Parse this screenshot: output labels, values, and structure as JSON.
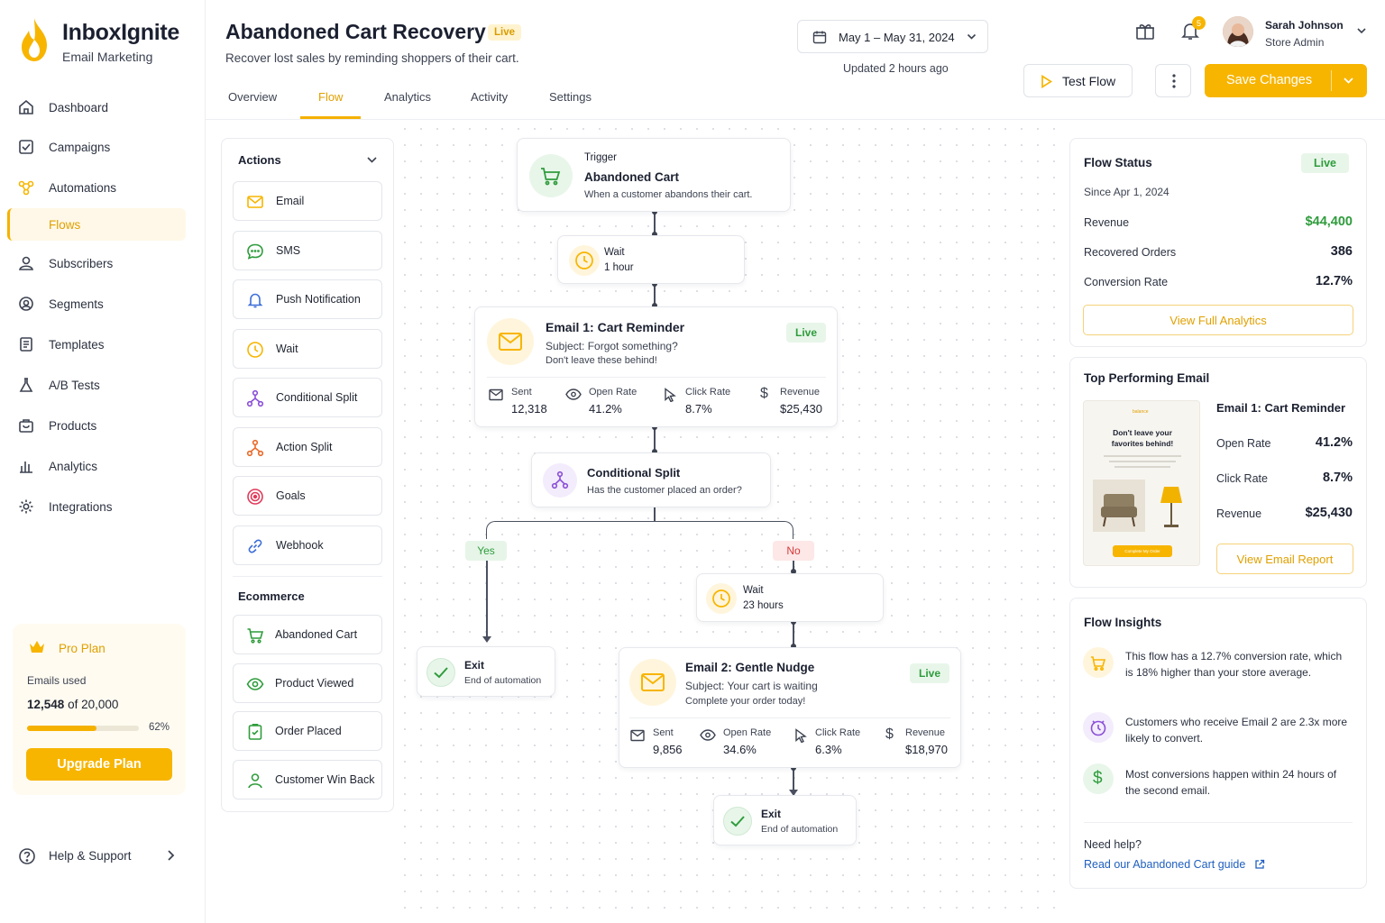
{
  "brand": {
    "name": "InboxIgnite",
    "tagline": "Email Marketing"
  },
  "nav": {
    "items": [
      "Dashboard",
      "Campaigns",
      "Automations",
      "Flows",
      "Subscribers",
      "Segments",
      "Templates",
      "A/B Tests",
      "Products",
      "Analytics",
      "Integrations"
    ],
    "active": "Flows",
    "help": "Help & Support"
  },
  "plan": {
    "name": "Pro Plan",
    "usage_label": "Emails used",
    "used": "12,548",
    "of_text": "of 20,000",
    "percent_text": "62%",
    "percent": 0.62,
    "upgrade": "Upgrade Plan"
  },
  "header": {
    "title": "Abandoned Cart Recovery",
    "status": "Live",
    "subtitle": "Recover lost sales by reminding shoppers of their cart.",
    "tabs": [
      "Overview",
      "Flow",
      "Analytics",
      "Activity",
      "Settings"
    ],
    "active_tab": "Flow",
    "date_range": "May 1 – May 31, 2024",
    "updated": "Updated 2 hours ago",
    "notification_count": "5",
    "user_name": "Sarah Johnson",
    "user_role": "Store Admin",
    "test_flow": "Test Flow",
    "save": "Save Changes"
  },
  "palette": {
    "actions_title": "Actions",
    "actions": [
      "Email",
      "SMS",
      "Push Notification",
      "Wait",
      "Conditional Split",
      "Action Split",
      "Goals",
      "Webhook"
    ],
    "ecommerce_title": "Ecommerce",
    "ecommerce": [
      "Abandoned Cart",
      "Product Viewed",
      "Order Placed",
      "Customer Win Back"
    ]
  },
  "flow": {
    "trigger": {
      "label": "Trigger",
      "title": "Abandoned Cart",
      "desc": "When a customer abandons their cart."
    },
    "wait1": {
      "label": "Wait",
      "value": "1 hour"
    },
    "email1": {
      "title": "Email 1: Cart Reminder",
      "status": "Live",
      "subject": "Subject: Forgot something?",
      "preview": "Don't leave these behind!",
      "stats": [
        {
          "label": "Sent",
          "value": "12,318"
        },
        {
          "label": "Open Rate",
          "value": "41.2%"
        },
        {
          "label": "Click Rate",
          "value": "8.7%"
        },
        {
          "label": "Revenue",
          "value": "$25,430"
        }
      ]
    },
    "split": {
      "title": "Conditional Split",
      "desc": "Has the customer placed an order?",
      "yes": "Yes",
      "no": "No"
    },
    "exit_yes": {
      "title": "Exit",
      "desc": "End of automation"
    },
    "wait2": {
      "label": "Wait",
      "value": "23 hours"
    },
    "email2": {
      "title": "Email 2: Gentle Nudge",
      "status": "Live",
      "subject": "Subject: Your cart is waiting",
      "preview": "Complete your order today!",
      "stats": [
        {
          "label": "Sent",
          "value": "9,856"
        },
        {
          "label": "Open Rate",
          "value": "34.6%"
        },
        {
          "label": "Click Rate",
          "value": "6.3%"
        },
        {
          "label": "Revenue",
          "value": "$18,970"
        }
      ]
    },
    "exit_no": {
      "title": "Exit",
      "desc": "End of automation"
    }
  },
  "status_card": {
    "title": "Flow Status",
    "status": "Live",
    "since": "Since Apr 1, 2024",
    "rows": [
      {
        "label": "Revenue",
        "value": "$44,400"
      },
      {
        "label": "Recovered Orders",
        "value": "386"
      },
      {
        "label": "Conversion Rate",
        "value": "12.7%"
      }
    ],
    "button": "View Full Analytics"
  },
  "top_email": {
    "title": "Top Performing Email",
    "email_name": "Email 1: Cart Reminder",
    "rows": [
      {
        "label": "Open Rate",
        "value": "41.2%"
      },
      {
        "label": "Click Rate",
        "value": "8.7%"
      },
      {
        "label": "Revenue",
        "value": "$25,430"
      }
    ],
    "button": "View Email Report",
    "thumb": {
      "brand": "balance",
      "headline": "Don't leave your favorites behind!",
      "cta": "Complete My Order"
    }
  },
  "insights": {
    "title": "Flow Insights",
    "items": [
      "This flow has a 12.7% conversion rate, which is 18% higher than your store average.",
      "Customers who receive Email 2 are 2.3x more likely to convert.",
      "Most conversions happen within 24 hours of the second email."
    ],
    "help_label": "Need help?",
    "help_link": "Read our Abandoned Cart guide"
  },
  "colors": {
    "accent": "#f7b500",
    "success": "#2f9c3c",
    "text": "#1b2030"
  }
}
